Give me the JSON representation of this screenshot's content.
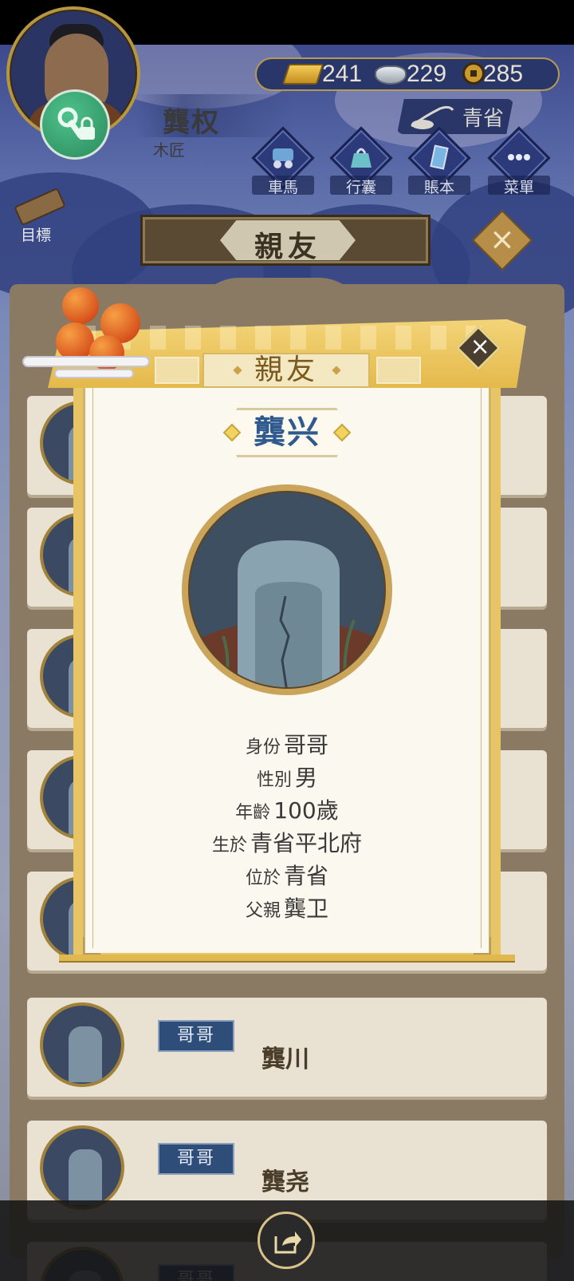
{
  "header": {
    "player_name": "龔权",
    "player_job": "木匠",
    "location": "青省",
    "currency": {
      "gold": "241",
      "silver": "229",
      "coins": "285"
    }
  },
  "menu": {
    "items": [
      {
        "label": "車馬",
        "icon": "carriage-icon"
      },
      {
        "label": "行囊",
        "icon": "bag-icon"
      },
      {
        "label": "賬本",
        "icon": "ledger-icon"
      },
      {
        "label": "菜單",
        "icon": "more-icon"
      }
    ],
    "goal_label": "目標"
  },
  "panel": {
    "title": "親友",
    "close_icon": "close-icon"
  },
  "list": {
    "rows": [
      {
        "role": "哥哥",
        "name": "龔川"
      },
      {
        "role": "哥哥",
        "name": "龔尧"
      },
      {
        "role": "哥哥",
        "name": ""
      }
    ]
  },
  "modal": {
    "title": "親友",
    "name": "龔兴",
    "portrait_icon": "tombstone-icon",
    "info": [
      {
        "key": "身份",
        "value": "哥哥"
      },
      {
        "key": "性別",
        "value": "男"
      },
      {
        "key": "年齡",
        "value": "100歲"
      },
      {
        "key": "生於",
        "value": "青省平北府"
      },
      {
        "key": "位於",
        "value": "青省"
      },
      {
        "key": "父親",
        "value": "龔卫"
      }
    ]
  },
  "bottom": {
    "share_icon": "share-icon"
  },
  "colors": {
    "accent_gold": "#e4b94b",
    "name_blue": "#2f5a8e",
    "role_badge": "#2f4d79"
  }
}
